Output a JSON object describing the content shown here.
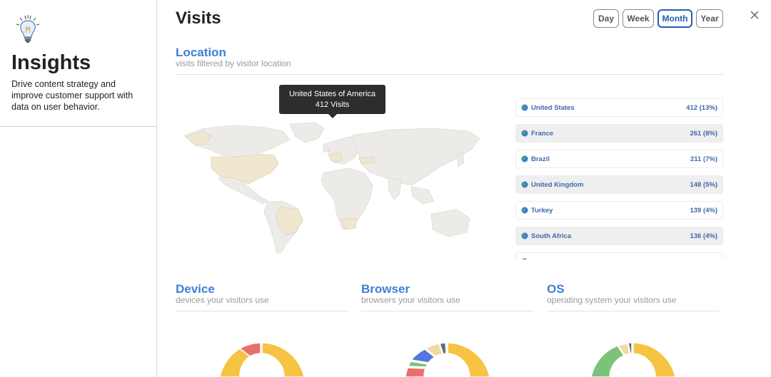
{
  "sidebar": {
    "title": "Insights",
    "description": "Drive content strategy and improve customer support with data on user behavior.",
    "logo_icon": "lightbulb-icon"
  },
  "header": {
    "title": "Visits",
    "periods": [
      "Day",
      "Week",
      "Month",
      "Year"
    ],
    "active_period": "Month",
    "close_icon": "close-icon"
  },
  "location": {
    "title": "Location",
    "subtitle": "visits filtered by visitor location",
    "tooltip": {
      "country": "United States of America",
      "visits": "412 Visits"
    },
    "countries": [
      {
        "name": "United States",
        "value": "412 (13%)"
      },
      {
        "name": "France",
        "value": "261 (8%)"
      },
      {
        "name": "Brazil",
        "value": "211 (7%)"
      },
      {
        "name": "United Kingdom",
        "value": "148 (5%)"
      },
      {
        "name": "Turkey",
        "value": "139 (4%)"
      },
      {
        "name": "South Africa",
        "value": "136 (4%)"
      }
    ]
  },
  "device": {
    "title": "Device",
    "subtitle": "devices your visitors use"
  },
  "browser": {
    "title": "Browser",
    "subtitle": "browsers your visitors use"
  },
  "os": {
    "title": "OS",
    "subtitle": "operating system your visitors use"
  },
  "colors": {
    "accent": "#3d7fd3",
    "active_border": "#1f5fb4",
    "yellow": "#f6c342",
    "red": "#e8706a",
    "blue": "#5578e0",
    "green": "#7cc37a",
    "cream": "#f4d9a0",
    "slate": "#5e6b73"
  }
}
